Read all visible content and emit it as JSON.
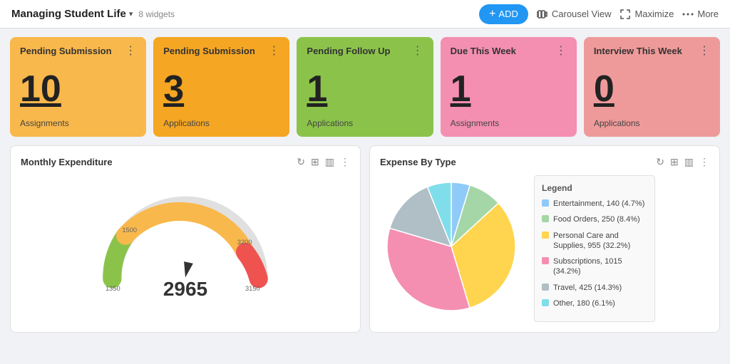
{
  "header": {
    "title": "Managing Student Life",
    "widgets_count": "8 widgets",
    "add_label": "ADD",
    "carousel_label": "Carousel View",
    "maximize_label": "Maximize",
    "more_label": "More"
  },
  "cards": [
    {
      "id": "card-1",
      "title": "Pending Submission",
      "number": "10",
      "label": "Assignments",
      "color_class": "card-orange"
    },
    {
      "id": "card-2",
      "title": "Pending Submission",
      "number": "3",
      "label": "Applications",
      "color_class": "card-orange2"
    },
    {
      "id": "card-3",
      "title": "Pending Follow Up",
      "number": "1",
      "label": "Applications",
      "color_class": "card-green"
    },
    {
      "id": "card-4",
      "title": "Due This Week",
      "number": "1",
      "label": "Assignments",
      "color_class": "card-pink"
    },
    {
      "id": "card-5",
      "title": "Interview This Week",
      "number": "0",
      "label": "Applications",
      "color_class": "card-salmon"
    }
  ],
  "monthly_expenditure": {
    "title": "Monthly Expenditure",
    "value": "2965",
    "min": "1350",
    "max": "3200",
    "mid_low": "1500",
    "mid_high": "3150"
  },
  "expense_by_type": {
    "title": "Expense By Type",
    "legend_title": "Legend",
    "segments": [
      {
        "label": "Entertainment, 140 (4.7%)",
        "color": "#90CAF9",
        "value": 140,
        "pct": 4.7
      },
      {
        "label": "Food Orders, 250 (8.4%)",
        "color": "#A5D6A7",
        "value": 250,
        "pct": 8.4
      },
      {
        "label": "Personal Care and Supplies, 955 (32.2%)",
        "color": "#FFD54F",
        "value": 955,
        "pct": 32.2
      },
      {
        "label": "Subscriptions, 1015 (34.2%)",
        "color": "#F48FB1",
        "value": 1015,
        "pct": 34.2
      },
      {
        "label": "Travel, 425 (14.3%)",
        "color": "#B0BEC5",
        "value": 425,
        "pct": 14.3
      },
      {
        "label": "Other, 180 (6.1%)",
        "color": "#80DEEA",
        "value": 180,
        "pct": 6.1
      }
    ]
  }
}
